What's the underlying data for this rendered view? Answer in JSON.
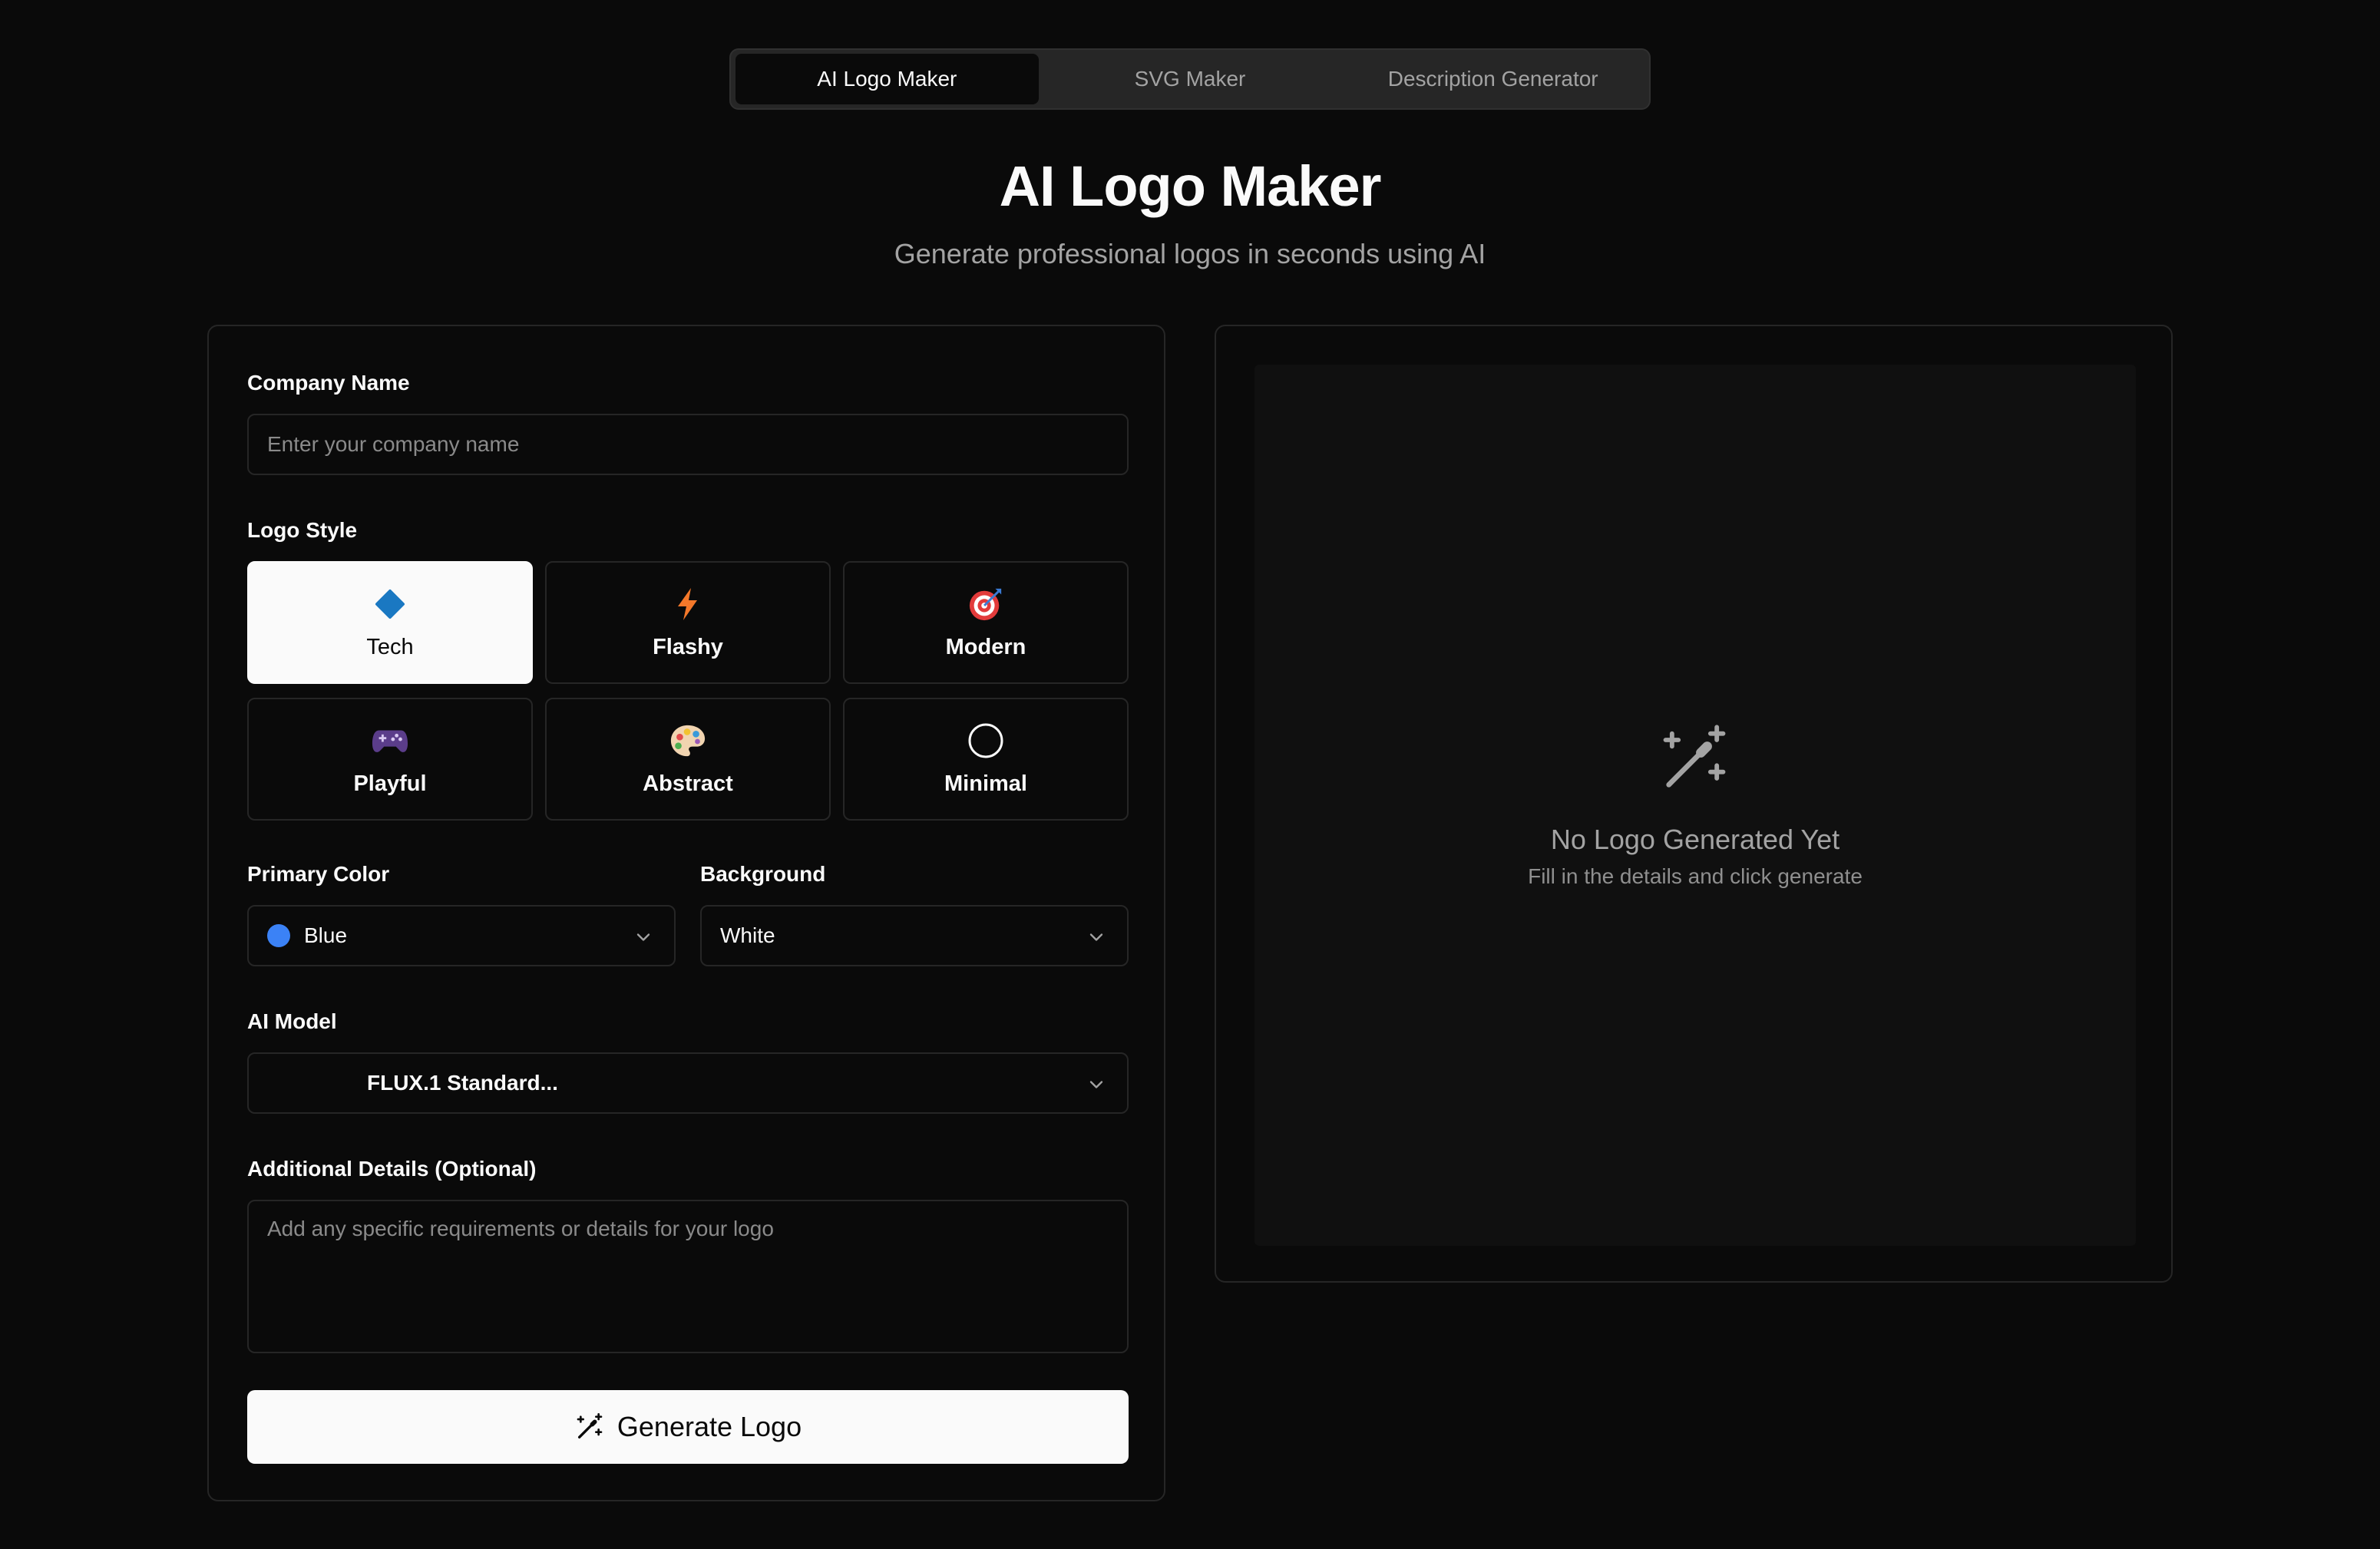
{
  "tabs": [
    {
      "label": "AI Logo Maker",
      "active": true
    },
    {
      "label": "SVG Maker",
      "active": false
    },
    {
      "label": "Description Generator",
      "active": false
    }
  ],
  "header": {
    "title": "AI Logo Maker",
    "subtitle": "Generate professional logos in seconds using AI"
  },
  "form": {
    "company_label": "Company Name",
    "company_placeholder": "Enter your company name",
    "company_value": "",
    "style_label": "Logo Style",
    "styles": [
      {
        "name": "Tech",
        "icon": "diamond-icon",
        "selected": true
      },
      {
        "name": "Flashy",
        "icon": "lightning-icon",
        "selected": false
      },
      {
        "name": "Modern",
        "icon": "target-icon",
        "selected": false
      },
      {
        "name": "Playful",
        "icon": "game-controller-icon",
        "selected": false
      },
      {
        "name": "Abstract",
        "icon": "palette-icon",
        "selected": false
      },
      {
        "name": "Minimal",
        "icon": "circle-icon",
        "selected": false
      }
    ],
    "primary_color_label": "Primary Color",
    "primary_color_value": "Blue",
    "primary_color_swatch": "#3b82f6",
    "background_label": "Background",
    "background_value": "White",
    "model_label": "AI Model",
    "model_value": "FLUX.1 Standard...",
    "details_label": "Additional Details (Optional)",
    "details_placeholder": "Add any specific requirements or details for your logo",
    "generate_label": "Generate Logo"
  },
  "preview": {
    "empty_icon": "magic-wand-icon",
    "empty_title": "No Logo Generated Yet",
    "empty_subtitle": "Fill in the details and click generate"
  },
  "colors": {
    "background": "#0a0a0a",
    "foreground": "#fafafa",
    "muted": "#a3a3a3",
    "border": "#262626",
    "accent_blue": "#3b82f6"
  }
}
